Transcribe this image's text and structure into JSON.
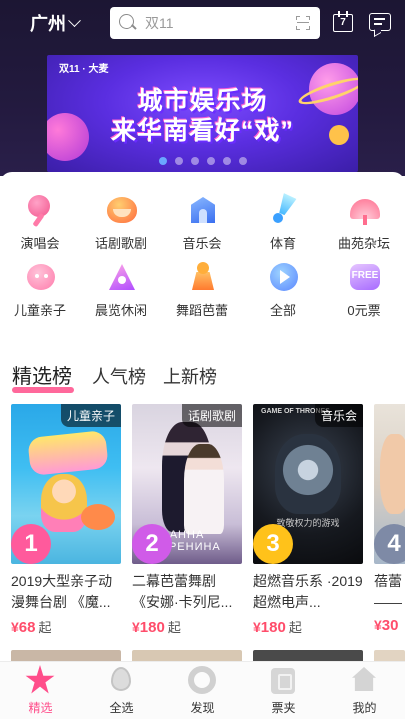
{
  "header": {
    "city": "广州",
    "search_placeholder": "双11",
    "calendar_day": "7"
  },
  "banner": {
    "tag": "双11 · 大麦",
    "line1": "城市娱乐场",
    "line2": "来华南看好“戏”",
    "dot_count": 6,
    "active_dot": 0
  },
  "categories": [
    {
      "label": "演唱会",
      "icon": "microphone-icon"
    },
    {
      "label": "话剧歌剧",
      "icon": "drama-mask-icon"
    },
    {
      "label": "音乐会",
      "icon": "music-hall-icon"
    },
    {
      "label": "体育",
      "icon": "badminton-icon"
    },
    {
      "label": "曲苑杂坛",
      "icon": "fan-icon"
    },
    {
      "label": "儿童亲子",
      "icon": "kids-face-icon"
    },
    {
      "label": "晨览休闲",
      "icon": "exhibition-icon"
    },
    {
      "label": "舞蹈芭蕾",
      "icon": "dance-icon"
    },
    {
      "label": "全部",
      "icon": "play-all-icon"
    },
    {
      "label": "0元票",
      "icon": "free-ticket-icon"
    }
  ],
  "tabs": [
    {
      "label": "精选榜",
      "active": true
    },
    {
      "label": "人气榜",
      "active": false
    },
    {
      "label": "上新榜",
      "active": false
    }
  ],
  "shows": [
    {
      "tag": "儿童亲子",
      "rank": "1",
      "rank_color": "#ff5a9c",
      "name": "2019大型亲子动漫舞台剧 《魔...",
      "currency": "¥",
      "price": "68",
      "suffix": "起"
    },
    {
      "tag": "话剧歌剧",
      "rank": "2",
      "rank_color": "#d05be8",
      "name": "二幕芭蕾舞剧 《安娜·卡列尼...",
      "currency": "¥",
      "price": "180",
      "suffix": "起",
      "poster_text": "АННА КАРЕНИНА"
    },
    {
      "tag": "音乐会",
      "rank": "3",
      "rank_color": "#ffc21a",
      "name": "超燃音乐系 ·2019超燃电声...",
      "currency": "¥",
      "price": "180",
      "suffix": "起",
      "poster_text_top": "GAME OF THRONES",
      "poster_text_sub": "致敬权力的游戏"
    },
    {
      "tag": "",
      "rank": "4",
      "rank_color": "#7e8aa6",
      "name": "蓓蕾 ——",
      "currency": "¥",
      "price": "30",
      "suffix": ""
    }
  ],
  "bottom_nav": [
    {
      "label": "精选",
      "icon": "star-icon",
      "active": true
    },
    {
      "label": "全选",
      "icon": "drop-icon",
      "active": false
    },
    {
      "label": "发现",
      "icon": "discover-icon",
      "active": false
    },
    {
      "label": "票夹",
      "icon": "ticket-icon",
      "active": false
    },
    {
      "label": "我的",
      "icon": "home-icon",
      "active": false
    }
  ],
  "colors": {
    "accent": "#ff4d8a",
    "price": "#ff4d6b",
    "header_bg": "#1c1633"
  }
}
